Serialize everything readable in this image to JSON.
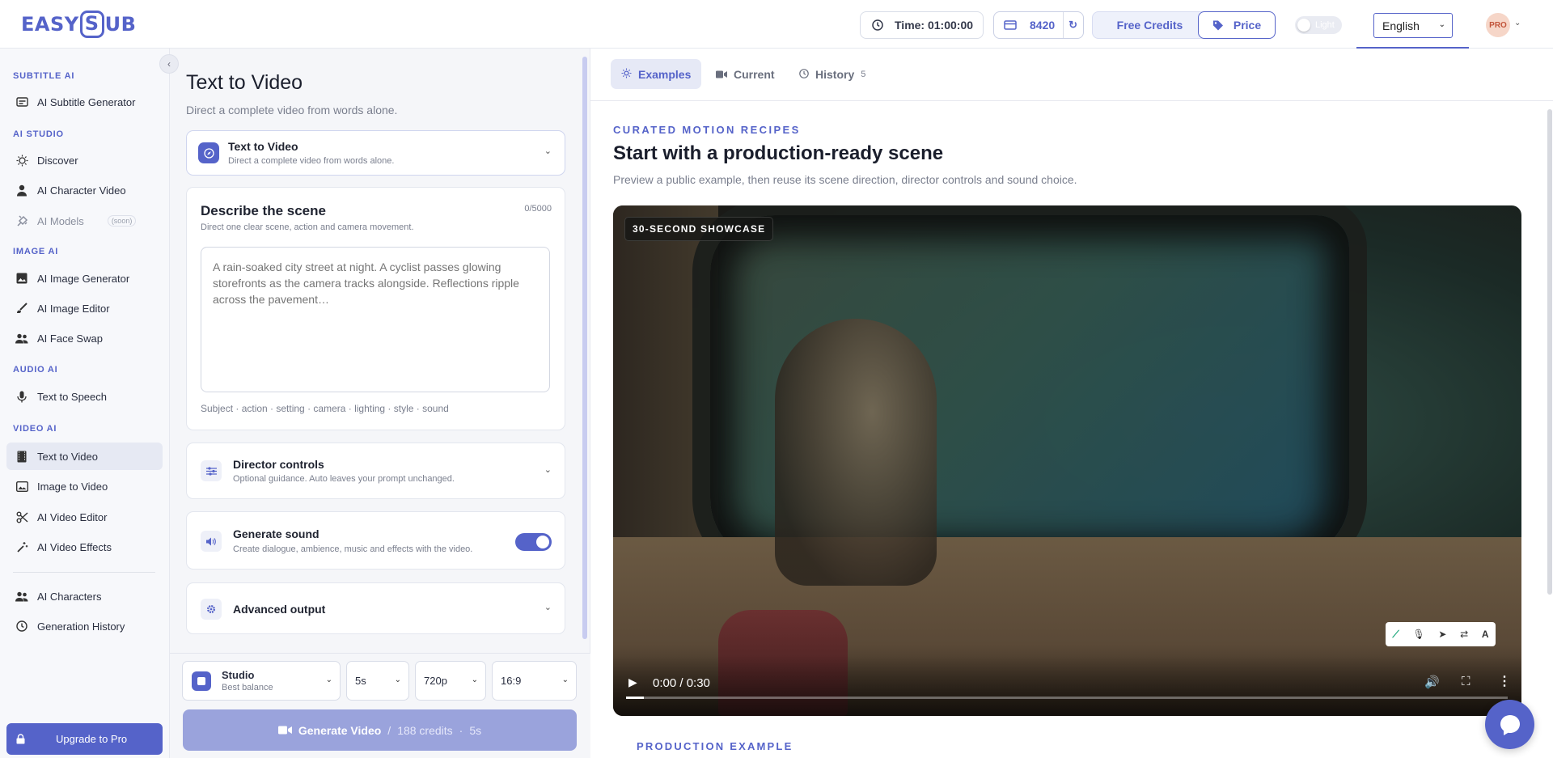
{
  "app": {
    "brand_left": "EASY",
    "brand_mid": "S",
    "brand_right": "UB"
  },
  "topbar": {
    "time_label": "Time: 01:00:00",
    "credits": "8420",
    "free_credits": "Free Credits",
    "price": "Price",
    "theme": "Light",
    "language": "English",
    "plan_badge": "PRO"
  },
  "sidebar": {
    "sections": {
      "subtitle_ai": "SUBTITLE AI",
      "ai_studio": "AI STUDIO",
      "image_ai": "IMAGE AI",
      "audio_ai": "AUDIO AI",
      "video_ai": "VIDEO AI"
    },
    "items": [
      {
        "label": "AI Subtitle Generator",
        "icon": "subtitle-icon"
      },
      {
        "label": "Discover",
        "icon": "lightbulb-icon"
      },
      {
        "label": "AI Character Video",
        "icon": "person-icon"
      },
      {
        "label": "AI Models",
        "icon": "plug-icon",
        "badge": "(soon)"
      },
      {
        "label": "AI Image Generator",
        "icon": "image-icon"
      },
      {
        "label": "AI Image Editor",
        "icon": "brush-icon"
      },
      {
        "label": "AI Face Swap",
        "icon": "people-icon"
      },
      {
        "label": "Text to Speech",
        "icon": "microphone-icon"
      },
      {
        "label": "Text to Video",
        "icon": "film-icon",
        "active": true
      },
      {
        "label": "Image to Video",
        "icon": "image-video-icon"
      },
      {
        "label": "AI Video Editor",
        "icon": "scissors-icon"
      },
      {
        "label": "AI Video Effects",
        "icon": "magic-wand-icon"
      },
      {
        "label": "AI Characters",
        "icon": "people-icon"
      },
      {
        "label": "Generation History",
        "icon": "clock-icon"
      }
    ],
    "upgrade": "Upgrade to Pro"
  },
  "form": {
    "title": "Text to Video",
    "subtitle": "Direct a complete video from words alone.",
    "mode": {
      "title": "Text to Video",
      "desc": "Direct a complete video from words alone."
    },
    "scene": {
      "title": "Describe the scene",
      "desc": "Direct one clear scene, action and camera movement.",
      "counter": "0/5000",
      "placeholder": "A rain-soaked city street at night. A cyclist passes glowing storefronts as the camera tracks alongside. Reflections ripple across the pavement…",
      "hints": "Subject · action · setting · camera · lighting · style · sound"
    },
    "director": {
      "title": "Director controls",
      "desc": "Optional guidance. Auto leaves your prompt unchanged."
    },
    "sound": {
      "title": "Generate sound",
      "desc": "Create dialogue, ambience, music and effects with the video.",
      "enabled": true
    },
    "advanced": {
      "title": "Advanced output"
    },
    "model": {
      "name": "Studio",
      "desc": "Best balance"
    },
    "duration": "5s",
    "resolution": "720p",
    "ratio": "16:9",
    "generate": {
      "label": "Generate Video",
      "slash": "/",
      "credits": "188 credits",
      "dot": "·",
      "duration": "5s"
    }
  },
  "right": {
    "tabs": [
      {
        "label": "Examples",
        "icon": "sparkle-icon",
        "active": true
      },
      {
        "label": "Current",
        "icon": "camera-icon"
      },
      {
        "label": "History",
        "icon": "clock-icon",
        "count": "5"
      }
    ],
    "eyebrow": "CURATED MOTION RECIPES",
    "title": "Start with a production-ready scene",
    "subtitle": "Preview a public example, then reuse its scene direction, director controls and sound choice.",
    "video": {
      "badge": "30-SECOND SHOWCASE",
      "timecode": "0:00 / 0:30",
      "progress": 0.02
    },
    "production_label": "PRODUCTION EXAMPLE"
  },
  "colors": {
    "accent": "#5563c9",
    "accent_light": "#e6e9f6",
    "generate_disabled": "#9aa3dc"
  }
}
